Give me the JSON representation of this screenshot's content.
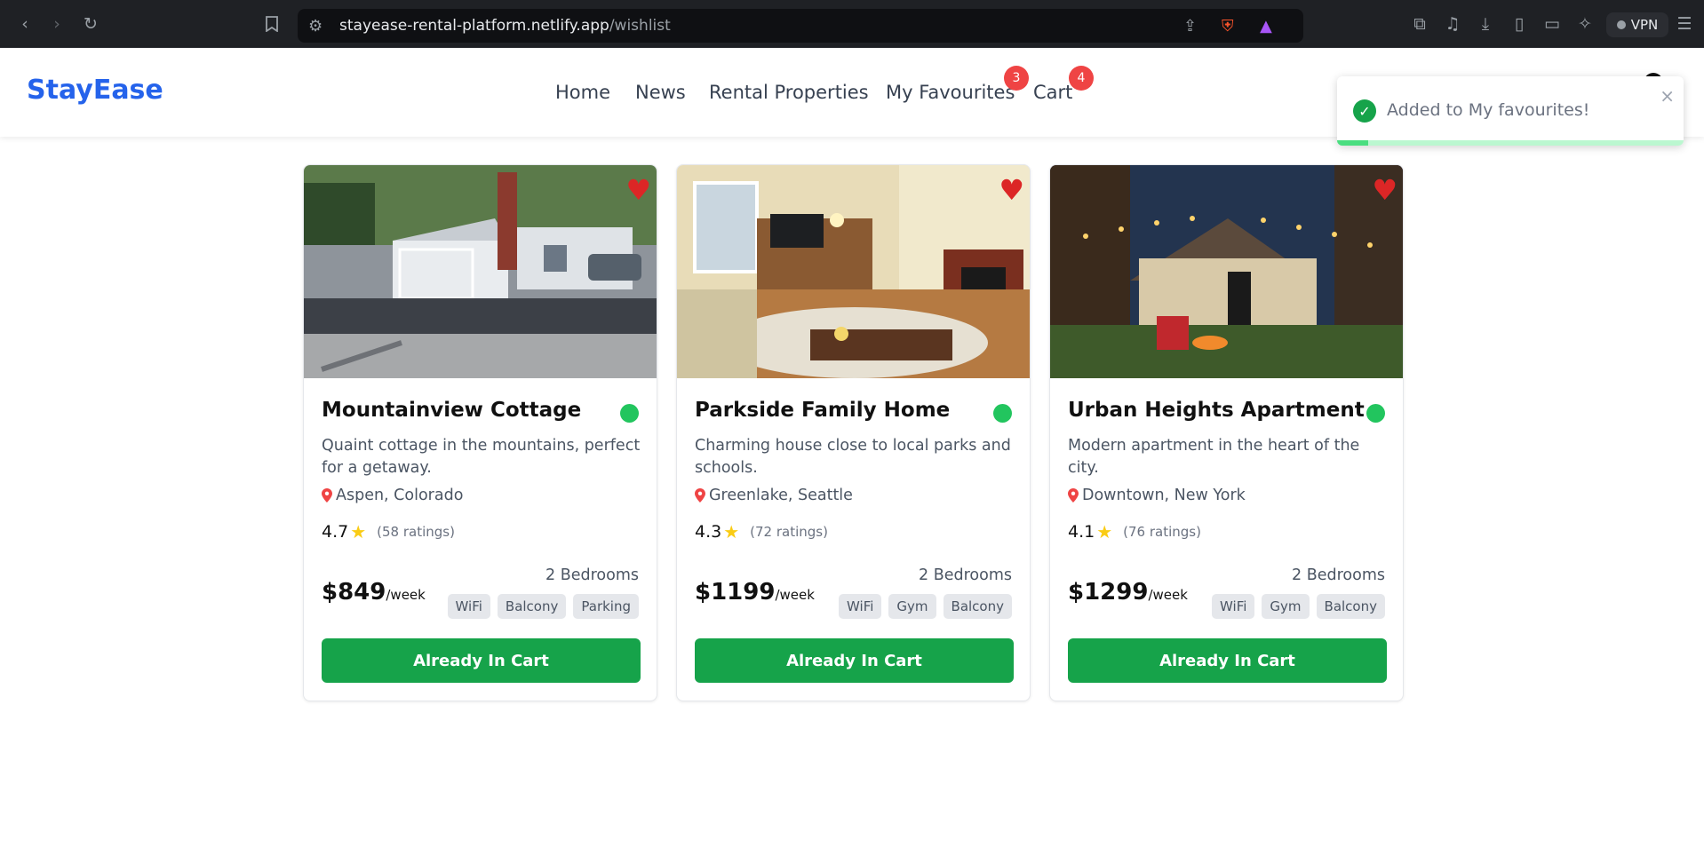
{
  "browser": {
    "url_host": "stayease-rental-platform.netlify.app",
    "url_path": "/wishlist",
    "vpn_label": "VPN"
  },
  "header": {
    "logo": "StayEase",
    "nav": [
      {
        "label": "Home"
      },
      {
        "label": "News"
      },
      {
        "label": "Rental Properties"
      },
      {
        "label": "My Favourites",
        "badge": "3"
      },
      {
        "label": "Cart",
        "badge": "4"
      }
    ]
  },
  "toast": {
    "message": "Added to My favourites!",
    "close_glyph": "×",
    "progress_fraction": 0.09,
    "accent": "#16a34a"
  },
  "cards": [
    {
      "title": "Mountainview Cottage",
      "description": "Quaint cottage in the mountains, perfect for a getaway.",
      "location": "Aspen, Colorado",
      "rating": "4.7",
      "ratings_count": "(58 ratings)",
      "price": "$849",
      "price_unit": "/week",
      "bedrooms": "2 Bedrooms",
      "amenities": [
        "WiFi",
        "Balcony",
        "Parking"
      ],
      "button": "Already In Cart"
    },
    {
      "title": "Parkside Family Home",
      "description": "Charming house close to local parks and schools.",
      "location": "Greenlake, Seattle",
      "rating": "4.3",
      "ratings_count": "(72 ratings)",
      "price": "$1199",
      "price_unit": "/week",
      "bedrooms": "2 Bedrooms",
      "amenities": [
        "WiFi",
        "Gym",
        "Balcony"
      ],
      "button": "Already In Cart"
    },
    {
      "title": "Urban Heights Apartment",
      "description": "Modern apartment in the heart of the city.",
      "location": "Downtown, New York",
      "rating": "4.1",
      "ratings_count": "(76 ratings)",
      "price": "$1299",
      "price_unit": "/week",
      "bedrooms": "2 Bedrooms",
      "amenities": [
        "WiFi",
        "Gym",
        "Balcony"
      ],
      "button": "Already In Cart"
    }
  ],
  "colors": {
    "brand": "#2563eb",
    "badge": "#ef4444",
    "button": "#16a34a",
    "available_dot": "#22c55e",
    "heart": "#dc2626"
  },
  "icons": [
    "back-icon",
    "forward-icon",
    "reload-icon",
    "bookmark-icon",
    "site-settings-icon",
    "share-icon",
    "brave-shield-icon",
    "brave-rewards-icon",
    "extensions-icon",
    "media-icon",
    "downloads-icon",
    "sidebar-icon",
    "wallet-icon",
    "leo-ai-icon",
    "menu-icon",
    "heart-icon",
    "map-pin-icon",
    "star-icon",
    "check-circle-icon",
    "close-icon"
  ]
}
